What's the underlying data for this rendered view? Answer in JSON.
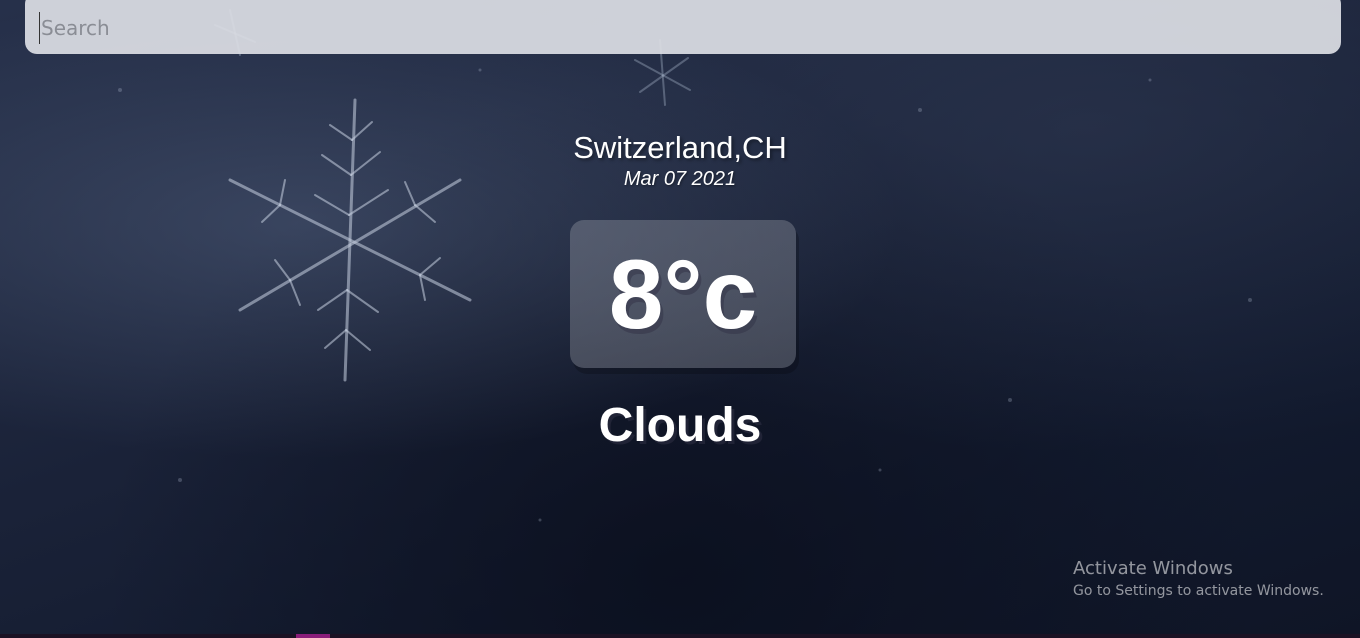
{
  "search": {
    "placeholder": "Search",
    "value": ""
  },
  "location": {
    "name": "Switzerland,CH",
    "date": "Mar 07 2021"
  },
  "weather": {
    "temperature": "8°c",
    "condition": "Clouds"
  },
  "os_overlay": {
    "title": "Activate Windows",
    "subtitle": "Go to Settings to activate Windows."
  },
  "colors": {
    "background": "#1a2238",
    "text": "#ffffff",
    "search_bg": "#dcdee4"
  },
  "icons": {
    "background_decor": "snowflake-icon"
  }
}
